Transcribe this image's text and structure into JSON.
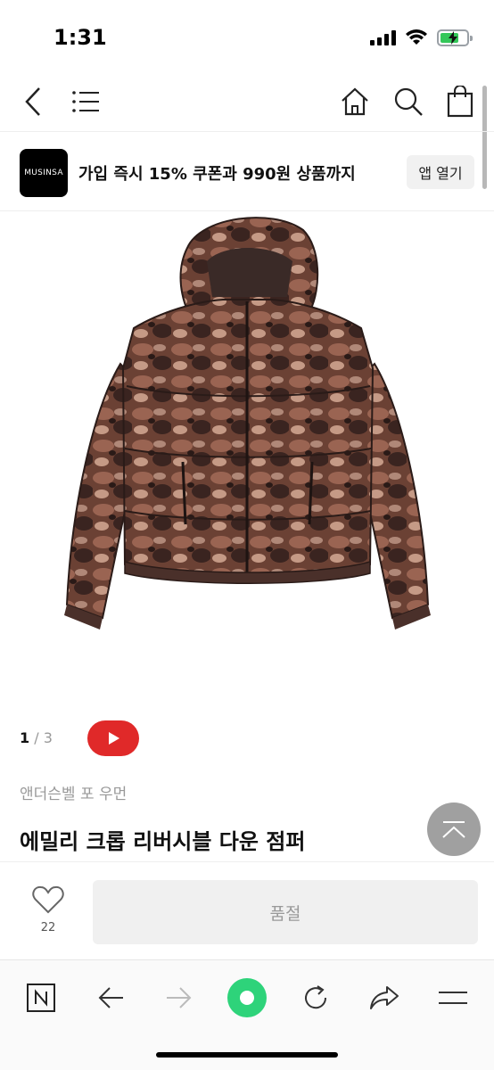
{
  "status": {
    "time": "1:31",
    "battery_level": 0.7
  },
  "nav": {
    "icons": [
      "back-icon",
      "menu-icon",
      "home-icon",
      "search-icon",
      "cart-icon"
    ]
  },
  "promo": {
    "logo_text": "MUSINSA",
    "text": "가입 즉시 15% 쿠폰과 990원 상품까지",
    "open_label": "앱 열기"
  },
  "gallery": {
    "current": "1",
    "separator": " / ",
    "total": "3"
  },
  "product": {
    "brand": "앤더슨벨 포 우먼",
    "title": "에밀리 크롭 리버시블 다운 점퍼",
    "like_count": "22",
    "soldout_label": "품절"
  },
  "colors": {
    "youtube_red": "#e02929",
    "browser_green": "#2ed37a"
  },
  "browser": {
    "icons": [
      "naver-icon",
      "back-arrow-icon",
      "forward-arrow-icon",
      "green-dot-icon",
      "refresh-icon",
      "share-icon",
      "menu-icon"
    ]
  }
}
